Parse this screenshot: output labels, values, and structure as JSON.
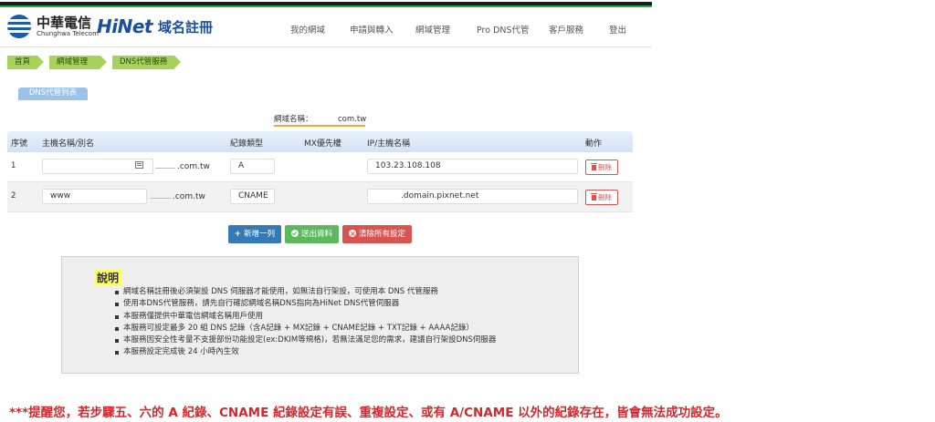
{
  "header": {
    "cht_name": "中華電信",
    "cht_en": "Chunghwa Telecom",
    "hinet_word": "HiNet",
    "hinet_service": "域名註冊",
    "nav": [
      "我的網域",
      "申請與轉入",
      "網域管理",
      "Pro DNS代管",
      "客戶服務",
      "登出"
    ]
  },
  "breadcrumb": [
    "首頁",
    "網域管理",
    "DNS代管服務"
  ],
  "section_title": "DNS代管列表",
  "domain": {
    "label": "網域名稱：",
    "value": "com.tw"
  },
  "table": {
    "headers": [
      "序號",
      "主機名稱/別名",
      "紀錄類型",
      "MX優先權",
      "IP/主機名稱",
      "動作"
    ],
    "rows": [
      {
        "index": "1",
        "host": "",
        "suffix": ".com.tw",
        "type": "A",
        "mx": "",
        "target": "103.23.108.108",
        "action": "刪除"
      },
      {
        "index": "2",
        "host": "www",
        "suffix": ".com.tw",
        "type": "CNAME",
        "mx": "",
        "target": ".domain.pixnet.net",
        "action": "刪除"
      }
    ]
  },
  "buttons": {
    "add": "新增一列",
    "save": "送出資料",
    "clear": "清除所有設定"
  },
  "info": {
    "title": "說明",
    "items": [
      "網域名稱註冊後必須架設 DNS 伺服器才能使用，如無法自行架設，可使用本 DNS 代管服務",
      "使用本DNS代管服務，請先自行確認網域名稱DNS指向為HiNet DNS代管伺服器",
      "本服務僅提供中華電信網域名稱用戶使用",
      "本服務可設定最多 20 組 DNS 記錄（含A記錄 + MX記錄 + CNAME記錄 + TXT記錄 + AAAA記錄）",
      "本服務因安全性考量不支援部份功能設定(ex:DKIM等規格)，若無法滿足您的需求，建議自行架設DNS伺服器",
      "本服務設定完成後 24 小時內生效"
    ]
  },
  "warning": "***提醒您，若步驟五、六的 A 紀錄、CNAME 紀錄設定有誤、重複設定、或有 A/CNAME 以外的紀錄存在，皆會無法成功設定。",
  "colors": {
    "accent": "#337ab7",
    "breadcrumb": "#a6d35a",
    "danger": "#d9534f",
    "success": "#5cb85c",
    "warning_text": "#d7262c"
  }
}
